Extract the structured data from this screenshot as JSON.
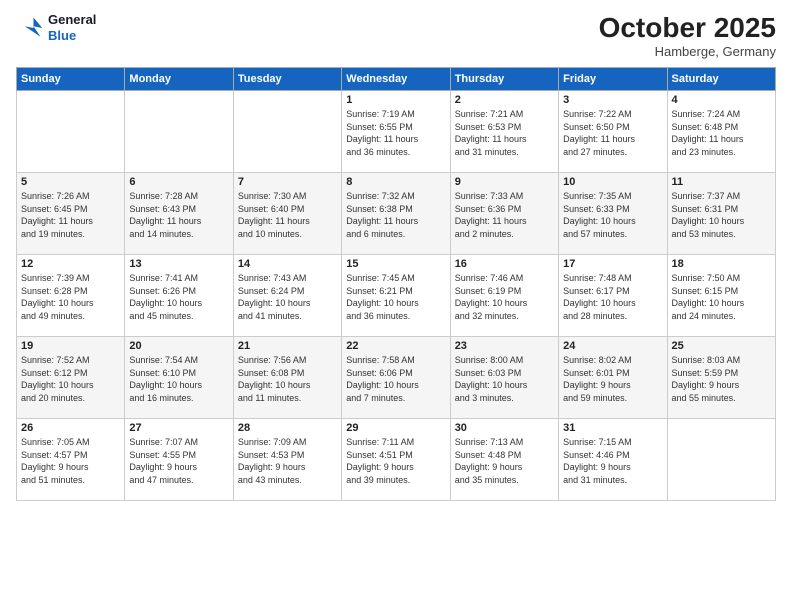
{
  "header": {
    "logo_line1": "General",
    "logo_line2": "Blue",
    "month": "October 2025",
    "location": "Hamberge, Germany"
  },
  "weekdays": [
    "Sunday",
    "Monday",
    "Tuesday",
    "Wednesday",
    "Thursday",
    "Friday",
    "Saturday"
  ],
  "weeks": [
    [
      {
        "day": "",
        "info": ""
      },
      {
        "day": "",
        "info": ""
      },
      {
        "day": "",
        "info": ""
      },
      {
        "day": "1",
        "info": "Sunrise: 7:19 AM\nSunset: 6:55 PM\nDaylight: 11 hours\nand 36 minutes."
      },
      {
        "day": "2",
        "info": "Sunrise: 7:21 AM\nSunset: 6:53 PM\nDaylight: 11 hours\nand 31 minutes."
      },
      {
        "day": "3",
        "info": "Sunrise: 7:22 AM\nSunset: 6:50 PM\nDaylight: 11 hours\nand 27 minutes."
      },
      {
        "day": "4",
        "info": "Sunrise: 7:24 AM\nSunset: 6:48 PM\nDaylight: 11 hours\nand 23 minutes."
      }
    ],
    [
      {
        "day": "5",
        "info": "Sunrise: 7:26 AM\nSunset: 6:45 PM\nDaylight: 11 hours\nand 19 minutes."
      },
      {
        "day": "6",
        "info": "Sunrise: 7:28 AM\nSunset: 6:43 PM\nDaylight: 11 hours\nand 14 minutes."
      },
      {
        "day": "7",
        "info": "Sunrise: 7:30 AM\nSunset: 6:40 PM\nDaylight: 11 hours\nand 10 minutes."
      },
      {
        "day": "8",
        "info": "Sunrise: 7:32 AM\nSunset: 6:38 PM\nDaylight: 11 hours\nand 6 minutes."
      },
      {
        "day": "9",
        "info": "Sunrise: 7:33 AM\nSunset: 6:36 PM\nDaylight: 11 hours\nand 2 minutes."
      },
      {
        "day": "10",
        "info": "Sunrise: 7:35 AM\nSunset: 6:33 PM\nDaylight: 10 hours\nand 57 minutes."
      },
      {
        "day": "11",
        "info": "Sunrise: 7:37 AM\nSunset: 6:31 PM\nDaylight: 10 hours\nand 53 minutes."
      }
    ],
    [
      {
        "day": "12",
        "info": "Sunrise: 7:39 AM\nSunset: 6:28 PM\nDaylight: 10 hours\nand 49 minutes."
      },
      {
        "day": "13",
        "info": "Sunrise: 7:41 AM\nSunset: 6:26 PM\nDaylight: 10 hours\nand 45 minutes."
      },
      {
        "day": "14",
        "info": "Sunrise: 7:43 AM\nSunset: 6:24 PM\nDaylight: 10 hours\nand 41 minutes."
      },
      {
        "day": "15",
        "info": "Sunrise: 7:45 AM\nSunset: 6:21 PM\nDaylight: 10 hours\nand 36 minutes."
      },
      {
        "day": "16",
        "info": "Sunrise: 7:46 AM\nSunset: 6:19 PM\nDaylight: 10 hours\nand 32 minutes."
      },
      {
        "day": "17",
        "info": "Sunrise: 7:48 AM\nSunset: 6:17 PM\nDaylight: 10 hours\nand 28 minutes."
      },
      {
        "day": "18",
        "info": "Sunrise: 7:50 AM\nSunset: 6:15 PM\nDaylight: 10 hours\nand 24 minutes."
      }
    ],
    [
      {
        "day": "19",
        "info": "Sunrise: 7:52 AM\nSunset: 6:12 PM\nDaylight: 10 hours\nand 20 minutes."
      },
      {
        "day": "20",
        "info": "Sunrise: 7:54 AM\nSunset: 6:10 PM\nDaylight: 10 hours\nand 16 minutes."
      },
      {
        "day": "21",
        "info": "Sunrise: 7:56 AM\nSunset: 6:08 PM\nDaylight: 10 hours\nand 11 minutes."
      },
      {
        "day": "22",
        "info": "Sunrise: 7:58 AM\nSunset: 6:06 PM\nDaylight: 10 hours\nand 7 minutes."
      },
      {
        "day": "23",
        "info": "Sunrise: 8:00 AM\nSunset: 6:03 PM\nDaylight: 10 hours\nand 3 minutes."
      },
      {
        "day": "24",
        "info": "Sunrise: 8:02 AM\nSunset: 6:01 PM\nDaylight: 9 hours\nand 59 minutes."
      },
      {
        "day": "25",
        "info": "Sunrise: 8:03 AM\nSunset: 5:59 PM\nDaylight: 9 hours\nand 55 minutes."
      }
    ],
    [
      {
        "day": "26",
        "info": "Sunrise: 7:05 AM\nSunset: 4:57 PM\nDaylight: 9 hours\nand 51 minutes."
      },
      {
        "day": "27",
        "info": "Sunrise: 7:07 AM\nSunset: 4:55 PM\nDaylight: 9 hours\nand 47 minutes."
      },
      {
        "day": "28",
        "info": "Sunrise: 7:09 AM\nSunset: 4:53 PM\nDaylight: 9 hours\nand 43 minutes."
      },
      {
        "day": "29",
        "info": "Sunrise: 7:11 AM\nSunset: 4:51 PM\nDaylight: 9 hours\nand 39 minutes."
      },
      {
        "day": "30",
        "info": "Sunrise: 7:13 AM\nSunset: 4:48 PM\nDaylight: 9 hours\nand 35 minutes."
      },
      {
        "day": "31",
        "info": "Sunrise: 7:15 AM\nSunset: 4:46 PM\nDaylight: 9 hours\nand 31 minutes."
      },
      {
        "day": "",
        "info": ""
      }
    ]
  ]
}
